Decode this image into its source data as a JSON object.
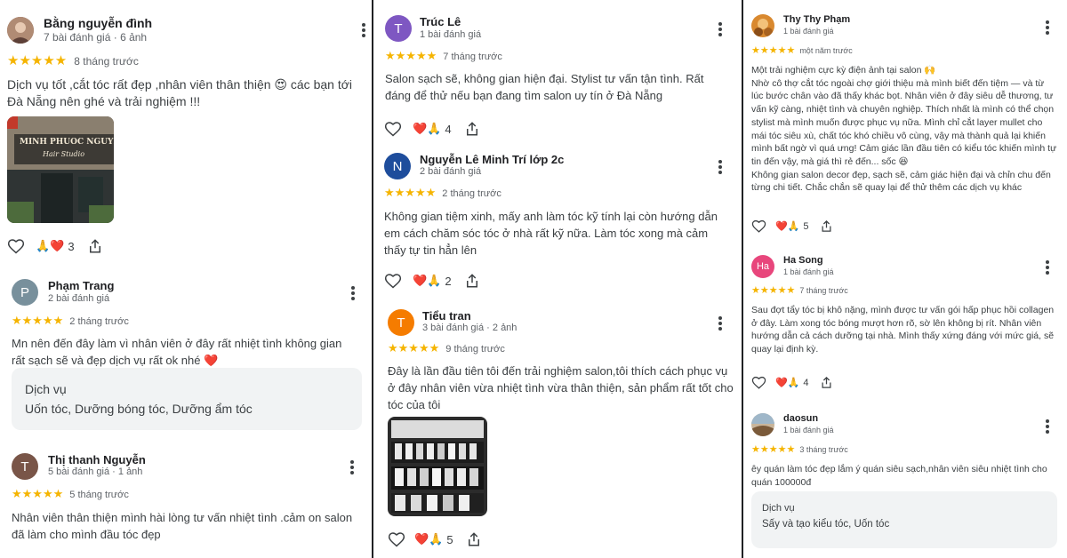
{
  "colors": {
    "star": "#f5b400",
    "text": "#3c4043",
    "muted": "#5f6368",
    "card": "#f1f3f4"
  },
  "col1": {
    "r1": {
      "name": "Bằng nguyễn đình",
      "meta": "7 bài đánh giá · 6 ảnh",
      "stars": "★★★★★",
      "time": "8 tháng trước",
      "text": "Dịch vụ tốt ,cắt tóc rất đẹp ,nhân viên thân thiện 😍 các bạn tới Đà Nẵng nên ghé và trải nghiệm !!!",
      "photo_sign1": "MINH PHUOC NGUYEN",
      "photo_sign2": "Hair Studio",
      "reactions": "3"
    },
    "r2": {
      "initial": "P",
      "name": "Phạm Trang",
      "meta": "2 bài đánh giá",
      "stars": "★★★★★",
      "time": "2 tháng trước",
      "text": "Mn nên đến đây làm vì nhân viên ở đây rất nhiệt tình không gian rất sạch sẽ và đẹp dịch vụ rất ok nhé ❤️",
      "service_title": "Dịch vụ",
      "service_value": "Uốn tóc, Dưỡng bóng tóc, Dưỡng ẩm tóc"
    },
    "r3": {
      "initial": "T",
      "name": "Thị thanh Nguyễn",
      "meta": "5 bài đánh giá · 1 ảnh",
      "stars": "★★★★★",
      "time": "5 tháng trước",
      "text": "Nhân viên thân thiện mình hài lòng tư vấn nhiệt tình .cảm on salon đã làm cho mình đầu tóc đẹp"
    }
  },
  "col2": {
    "r1": {
      "initial": "T",
      "name": "Trúc Lê",
      "meta": "1 bài đánh giá",
      "stars": "★★★★★",
      "time": "7 tháng trước",
      "text": "Salon sạch sẽ, không gian hiện đại. Stylist tư vấn tận tình. Rất đáng để thử nếu bạn đang tìm salon uy tín ở Đà Nẵng",
      "reactions": "4"
    },
    "r2": {
      "initial": "N",
      "name": "Nguyễn Lê Minh Trí lớp 2c",
      "meta": "2 bài đánh giá",
      "stars": "★★★★★",
      "time": "2 tháng trước",
      "text": "Không gian tiệm xinh, mấy anh làm tóc kỹ tính lại còn hướng dẫn em cách chăm sóc tóc ở nhà rất kỹ nữa. Làm tóc xong mà cảm thấy tự tin hẳn lên",
      "reactions": "2"
    },
    "r3": {
      "initial": "T",
      "name": "Tiểu tran",
      "meta": "3 bài đánh giá · 2 ảnh",
      "stars": "★★★★★",
      "time": "9 tháng trước",
      "text": "Đây là lần đầu tiên tôi đến trải nghiệm salon,tôi thích cách phục vụ ở đây nhân viên vừa nhiệt tình vừa thân thiện, sản phẩm rất tốt cho tóc của tôi",
      "reactions": "5"
    }
  },
  "col3": {
    "r1": {
      "name": "Thy Thy Phạm",
      "meta": "1 bài đánh giá",
      "stars": "★★★★★",
      "time": "một năm trước",
      "text": "Một trải nghiệm cực kỳ điện ảnh tại salon 🙌\nNhờ cô thợ cắt tóc ngoài chợ giới thiệu mà mình biết đến tiệm — và từ lúc bước chân vào đã thấy khác bọt. Nhân viên ở đây siêu dễ thương, tư vấn kỹ càng, nhiệt tình và chuyên nghiệp. Thích nhất là mình có thể chọn stylist mà mình muốn được phục vụ nữa. Mình chỉ cắt layer mullet cho mái tóc siêu xù, chất tóc khó chiều vô cùng, vậy mà thành quả lại khiến mình bất ngờ vì quá ưng! Cảm giác lần đầu tiên có kiểu tóc khiến mình tự tin đến vậy, mà giá thì rẻ đến... sốc 😆\nKhông gian salon decor đẹp, sạch sẽ, cảm giác hiện đại và chỉn chu đến từng chi tiết. Chắc chắn sẽ quay lại để thử thêm các dịch vụ khác",
      "reactions": "5"
    },
    "r2": {
      "initial": "Ha",
      "name": "Ha Song",
      "meta": "1 bài đánh giá",
      "stars": "★★★★★",
      "time": "7 tháng trước",
      "text": "Sau đợt tẩy tóc bị khô nặng, mình được tư vấn gói hấp phục hồi collagen ở đây. Làm xong tóc bóng mượt hơn rõ, sờ lên không bị rít. Nhân viên hướng dẫn cả cách dưỡng tại nhà. Mình thấy xứng đáng với mức giá, sẽ quay lại định kỳ.",
      "reactions": "4"
    },
    "r3": {
      "name": "daosun",
      "meta": "1 bài đánh giá",
      "stars": "★★★★★",
      "time": "3 tháng trước",
      "text": "êy quán làm tóc đẹp lắm ý quán siêu sạch,nhân viên siêu nhiệt tình cho quán 100000đ",
      "service_title": "Dịch vụ",
      "service_value": "Sấy và tạo kiểu tóc, Uốn tóc"
    }
  }
}
